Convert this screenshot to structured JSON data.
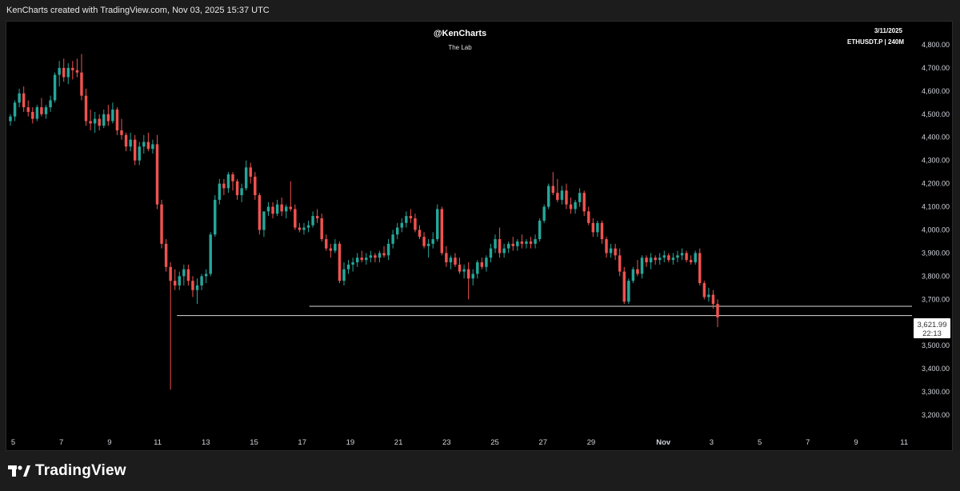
{
  "header": {
    "caption": "KenCharts created with TradingView.com, Nov 03, 2025 15:37 UTC"
  },
  "watermark": {
    "handle": "@KenCharts",
    "subtitle": "The Lab"
  },
  "info": {
    "date": "3/11/2025",
    "symbol": "ETHUSDT.P | 240M"
  },
  "price_tag": {
    "price": "3,621.99",
    "countdown": "22:13"
  },
  "footer": {
    "logo_text": "TradingView"
  },
  "colors": {
    "up": "#26a69a",
    "down": "#ef5350",
    "level": "#d9d9d9",
    "axis_text": "#d1d4dc",
    "background": "#000000"
  },
  "chart_data": {
    "type": "candlestick",
    "timeframe": "240M",
    "symbol": "ETHUSDT.P",
    "ylim": [
      3150,
      4850
    ],
    "y_ticks": [
      3200,
      3300,
      3400,
      3500,
      3600,
      3700,
      3800,
      3900,
      4000,
      4100,
      4200,
      4300,
      4400,
      4500,
      4600,
      4700,
      4800
    ],
    "y_tick_labels": [
      "3,200.00",
      "3,300.00",
      "3,400.00",
      "3,500.00",
      "3,600.00",
      "3,700.00",
      "3,800.00",
      "3,900.00",
      "4,000.00",
      "4,100.00",
      "4,200.00",
      "4,300.00",
      "4,400.00",
      "4,500.00",
      "4,600.00",
      "4,700.00",
      "4,800.00"
    ],
    "x_range_days": [
      4.9,
      12.0
    ],
    "x_ticks": [
      {
        "day": 5,
        "label": "5"
      },
      {
        "day": 7,
        "label": "7"
      },
      {
        "day": 9,
        "label": "9"
      },
      {
        "day": 11,
        "label": "11"
      },
      {
        "day": 13,
        "label": "13"
      },
      {
        "day": 15,
        "label": "15"
      },
      {
        "day": 17,
        "label": "17"
      },
      {
        "day": 19,
        "label": "19"
      },
      {
        "day": 21,
        "label": "21"
      },
      {
        "day": 23,
        "label": "23"
      },
      {
        "day": 25,
        "label": "25"
      },
      {
        "day": 27,
        "label": "27"
      },
      {
        "day": 29,
        "label": "29"
      },
      {
        "day": 32,
        "label": "Nov",
        "bold": true
      },
      {
        "day": 34,
        "label": "3"
      },
      {
        "day": 36,
        "label": "5"
      },
      {
        "day": 38,
        "label": "7"
      },
      {
        "day": 40,
        "label": "9"
      },
      {
        "day": 42,
        "label": "11"
      }
    ],
    "level_lines": [
      {
        "price": 3670,
        "from_day": 17.3
      },
      {
        "price": 3630,
        "from_day": 11.8
      }
    ],
    "last_price": 3621.99,
    "candles": [
      [
        4470,
        4500,
        4450,
        4490
      ],
      [
        4490,
        4560,
        4470,
        4550
      ],
      [
        4550,
        4610,
        4530,
        4590
      ],
      [
        4590,
        4620,
        4510,
        4530
      ],
      [
        4530,
        4560,
        4490,
        4510
      ],
      [
        4510,
        4530,
        4460,
        4480
      ],
      [
        4480,
        4540,
        4470,
        4530
      ],
      [
        4530,
        4570,
        4490,
        4500
      ],
      [
        4500,
        4540,
        4480,
        4530
      ],
      [
        4530,
        4580,
        4510,
        4560
      ],
      [
        4560,
        4680,
        4550,
        4670
      ],
      [
        4670,
        4730,
        4620,
        4700
      ],
      [
        4700,
        4740,
        4640,
        4660
      ],
      [
        4660,
        4720,
        4630,
        4700
      ],
      [
        4700,
        4730,
        4650,
        4690
      ],
      [
        4690,
        4740,
        4660,
        4680
      ],
      [
        4680,
        4760,
        4560,
        4580
      ],
      [
        4580,
        4610,
        4450,
        4470
      ],
      [
        4470,
        4520,
        4430,
        4460
      ],
      [
        4460,
        4510,
        4420,
        4480
      ],
      [
        4480,
        4500,
        4430,
        4450
      ],
      [
        4450,
        4520,
        4440,
        4500
      ],
      [
        4500,
        4540,
        4450,
        4470
      ],
      [
        4470,
        4550,
        4460,
        4520
      ],
      [
        4520,
        4530,
        4410,
        4430
      ],
      [
        4430,
        4480,
        4390,
        4410
      ],
      [
        4410,
        4420,
        4340,
        4360
      ],
      [
        4360,
        4420,
        4340,
        4390
      ],
      [
        4390,
        4410,
        4280,
        4300
      ],
      [
        4300,
        4380,
        4280,
        4360
      ],
      [
        4360,
        4410,
        4330,
        4380
      ],
      [
        4380,
        4420,
        4340,
        4350
      ],
      [
        4350,
        4390,
        4330,
        4370
      ],
      [
        4370,
        4410,
        4090,
        4110
      ],
      [
        4110,
        4130,
        3920,
        3940
      ],
      [
        3940,
        3960,
        3820,
        3840
      ],
      [
        3840,
        3860,
        3310,
        3780
      ],
      [
        3780,
        3830,
        3740,
        3760
      ],
      [
        3760,
        3820,
        3740,
        3800
      ],
      [
        3800,
        3850,
        3760,
        3830
      ],
      [
        3830,
        3850,
        3760,
        3780
      ],
      [
        3780,
        3800,
        3710,
        3740
      ],
      [
        3740,
        3790,
        3680,
        3760
      ],
      [
        3760,
        3810,
        3740,
        3800
      ],
      [
        3800,
        3830,
        3770,
        3810
      ],
      [
        3810,
        3990,
        3800,
        3980
      ],
      [
        3980,
        4150,
        3970,
        4130
      ],
      [
        4130,
        4220,
        4110,
        4200
      ],
      [
        4200,
        4220,
        4150,
        4180
      ],
      [
        4180,
        4250,
        4160,
        4240
      ],
      [
        4240,
        4250,
        4170,
        4210
      ],
      [
        4210,
        4220,
        4130,
        4150
      ],
      [
        4150,
        4200,
        4120,
        4180
      ],
      [
        4180,
        4300,
        4170,
        4270
      ],
      [
        4270,
        4290,
        4200,
        4230
      ],
      [
        4230,
        4250,
        4130,
        4150
      ],
      [
        4150,
        4160,
        3980,
        4000
      ],
      [
        4000,
        4060,
        3970,
        4080
      ],
      [
        4080,
        4120,
        4060,
        4100
      ],
      [
        4100,
        4120,
        4050,
        4070
      ],
      [
        4070,
        4130,
        4060,
        4110
      ],
      [
        4110,
        4140,
        4060,
        4080
      ],
      [
        4080,
        4110,
        4050,
        4100
      ],
      [
        4100,
        4210,
        4080,
        4090
      ],
      [
        4090,
        4110,
        4000,
        4010
      ],
      [
        4010,
        4030,
        3990,
        4000
      ],
      [
        4000,
        4030,
        3980,
        4010
      ],
      [
        4010,
        4040,
        3990,
        4020
      ],
      [
        4020,
        4080,
        4010,
        4060
      ],
      [
        4060,
        4090,
        4030,
        4050
      ],
      [
        4050,
        4070,
        3950,
        3960
      ],
      [
        3960,
        3980,
        3910,
        3920
      ],
      [
        3920,
        3940,
        3880,
        3910
      ],
      [
        3910,
        3960,
        3900,
        3940
      ],
      [
        3940,
        3950,
        3770,
        3780
      ],
      [
        3780,
        3860,
        3760,
        3830
      ],
      [
        3830,
        3870,
        3810,
        3850
      ],
      [
        3850,
        3880,
        3820,
        3860
      ],
      [
        3860,
        3900,
        3840,
        3880
      ],
      [
        3880,
        3910,
        3860,
        3870
      ],
      [
        3870,
        3900,
        3850,
        3880
      ],
      [
        3880,
        3910,
        3860,
        3890
      ],
      [
        3890,
        3900,
        3860,
        3880
      ],
      [
        3880,
        3910,
        3860,
        3900
      ],
      [
        3900,
        3930,
        3880,
        3890
      ],
      [
        3890,
        3960,
        3870,
        3940
      ],
      [
        3940,
        4000,
        3920,
        3980
      ],
      [
        3980,
        4030,
        3960,
        4010
      ],
      [
        4010,
        4050,
        3990,
        4030
      ],
      [
        4030,
        4080,
        4010,
        4060
      ],
      [
        4060,
        4090,
        4030,
        4050
      ],
      [
        4050,
        4070,
        3990,
        4000
      ],
      [
        4000,
        4020,
        3960,
        3970
      ],
      [
        3970,
        3990,
        3920,
        3930
      ],
      [
        3930,
        3960,
        3880,
        3940
      ],
      [
        3940,
        3990,
        3920,
        3960
      ],
      [
        3960,
        4110,
        3950,
        4090
      ],
      [
        4090,
        4100,
        3890,
        3900
      ],
      [
        3900,
        3930,
        3840,
        3860
      ],
      [
        3860,
        3890,
        3830,
        3880
      ],
      [
        3880,
        3900,
        3840,
        3850
      ],
      [
        3850,
        3880,
        3810,
        3820
      ],
      [
        3820,
        3850,
        3790,
        3830
      ],
      [
        3830,
        3860,
        3700,
        3790
      ],
      [
        3790,
        3830,
        3760,
        3810
      ],
      [
        3810,
        3870,
        3790,
        3860
      ],
      [
        3860,
        3880,
        3830,
        3840
      ],
      [
        3840,
        3890,
        3820,
        3880
      ],
      [
        3880,
        3940,
        3860,
        3920
      ],
      [
        3920,
        3980,
        3900,
        3960
      ],
      [
        3960,
        4010,
        3880,
        3900
      ],
      [
        3900,
        3940,
        3880,
        3920
      ],
      [
        3920,
        3950,
        3900,
        3940
      ],
      [
        3940,
        3970,
        3910,
        3930
      ],
      [
        3930,
        3960,
        3910,
        3950
      ],
      [
        3950,
        3980,
        3920,
        3940
      ],
      [
        3940,
        3960,
        3920,
        3950
      ],
      [
        3950,
        3970,
        3920,
        3940
      ],
      [
        3940,
        3980,
        3920,
        3960
      ],
      [
        3960,
        4050,
        3950,
        4040
      ],
      [
        4040,
        4110,
        4030,
        4100
      ],
      [
        4100,
        4200,
        4090,
        4190
      ],
      [
        4190,
        4250,
        4150,
        4160
      ],
      [
        4160,
        4220,
        4120,
        4130
      ],
      [
        4130,
        4190,
        4110,
        4170
      ],
      [
        4170,
        4200,
        4090,
        4110
      ],
      [
        4110,
        4140,
        4070,
        4090
      ],
      [
        4090,
        4130,
        4070,
        4120
      ],
      [
        4120,
        4180,
        4100,
        4160
      ],
      [
        4160,
        4170,
        4060,
        4080
      ],
      [
        4080,
        4100,
        4020,
        4030
      ],
      [
        4030,
        4050,
        3970,
        3990
      ],
      [
        3990,
        4040,
        3970,
        4030
      ],
      [
        4030,
        4040,
        3940,
        3960
      ],
      [
        3960,
        3970,
        3880,
        3900
      ],
      [
        3900,
        3940,
        3880,
        3920
      ],
      [
        3920,
        3940,
        3870,
        3890
      ],
      [
        3890,
        3920,
        3800,
        3820
      ],
      [
        3820,
        3840,
        3680,
        3690
      ],
      [
        3690,
        3790,
        3680,
        3780
      ],
      [
        3780,
        3840,
        3770,
        3830
      ],
      [
        3830,
        3870,
        3800,
        3810
      ],
      [
        3810,
        3890,
        3790,
        3880
      ],
      [
        3880,
        3890,
        3840,
        3860
      ],
      [
        3860,
        3900,
        3830,
        3880
      ],
      [
        3880,
        3890,
        3850,
        3870
      ],
      [
        3870,
        3900,
        3850,
        3880
      ],
      [
        3880,
        3910,
        3860,
        3890
      ],
      [
        3890,
        3900,
        3860,
        3870
      ],
      [
        3870,
        3900,
        3850,
        3880
      ],
      [
        3880,
        3910,
        3860,
        3890
      ],
      [
        3890,
        3920,
        3870,
        3900
      ],
      [
        3900,
        3910,
        3860,
        3870
      ],
      [
        3870,
        3890,
        3850,
        3860
      ],
      [
        3860,
        3910,
        3850,
        3900
      ],
      [
        3900,
        3920,
        3760,
        3770
      ],
      [
        3770,
        3780,
        3700,
        3710
      ],
      [
        3710,
        3750,
        3690,
        3720
      ],
      [
        3720,
        3740,
        3660,
        3680
      ],
      [
        3680,
        3700,
        3580,
        3622
      ]
    ]
  }
}
